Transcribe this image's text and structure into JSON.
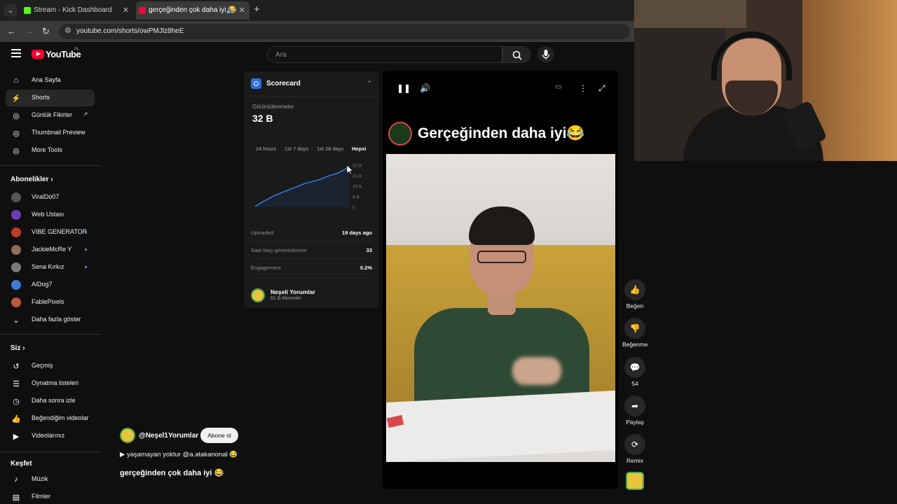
{
  "browser": {
    "tabs": [
      {
        "title": "Stream - Kick Dashboard",
        "favicon_color": "#53fc18"
      },
      {
        "title": "gerçeğinden çok daha iyi 😂",
        "favicon_color": "#ff0033"
      }
    ],
    "url": "youtube.com/shorts/owPMJlz8heE"
  },
  "header": {
    "logo_text": "YouTube",
    "country_code": "PL",
    "search_placeholder": "Ara"
  },
  "sidebar": {
    "main": [
      {
        "label": "Ana Sayfa"
      },
      {
        "label": "Shorts"
      },
      {
        "label": "Günlük Fikirler"
      },
      {
        "label": "Thumbnail Preview"
      },
      {
        "label": "More Tools"
      }
    ],
    "subscriptions_title": "Abonelikler",
    "subscriptions": [
      {
        "label": "ViralDo07",
        "color": "#555555",
        "dot": false
      },
      {
        "label": "Web Ustası",
        "color": "#6a3fb5",
        "dot": false
      },
      {
        "label": "VIBE GENERATOR",
        "color": "#c0392b",
        "dot": true
      },
      {
        "label": "JackieMcRe Y",
        "color": "#8e6f5a",
        "dot": true
      },
      {
        "label": "Sena Kırkız",
        "color": "#7a7a7a",
        "dot": true
      },
      {
        "label": "AiDog7",
        "color": "#3b7bd4",
        "dot": false
      },
      {
        "label": "FablePixels",
        "color": "#b85a3a",
        "dot": false
      }
    ],
    "show_more": "Daha fazla göster",
    "you_title": "Siz",
    "you": [
      {
        "label": "Geçmiş"
      },
      {
        "label": "Oynatma listeleri"
      },
      {
        "label": "Daha sonra izle"
      },
      {
        "label": "Beğendiğim videolar"
      },
      {
        "label": "Videolarınız"
      }
    ],
    "explore_title": "Keşfet",
    "explore": [
      {
        "label": "Müzik"
      },
      {
        "label": "Filmler"
      }
    ]
  },
  "scorecard": {
    "title": "Scorecard",
    "views_label": "Görüntülenmeler",
    "views_value": "32 B",
    "ranges": [
      "24 hours",
      "1st 7 days",
      "1st 28 days",
      "Hepsi"
    ],
    "selected_range": "Hepsi",
    "rows": [
      {
        "label": "Uploaded",
        "value": "19 days ago"
      },
      {
        "label": "Saat başı görüntülenme",
        "value": "33"
      },
      {
        "label": "Engagement",
        "value": "0.2%"
      }
    ],
    "channel_name": "Neşeli Yorumlar",
    "channel_subs": "61 B Aboneler"
  },
  "chart_data": {
    "type": "line",
    "y_tick_labels": [
      "32 B",
      "24 B",
      "16 B",
      "8 B",
      "0"
    ],
    "ylim": [
      0,
      32
    ],
    "x": [
      0,
      1,
      2,
      3,
      4,
      5,
      6,
      7,
      8,
      9,
      10,
      11,
      12,
      13,
      14,
      15,
      16,
      17,
      18,
      19
    ],
    "values": [
      0.5,
      3,
      5,
      7,
      9,
      10.5,
      12,
      13.5,
      15,
      16.5,
      18,
      19,
      20,
      21,
      22.5,
      24,
      25,
      26.5,
      28.5,
      31
    ],
    "color": "#3b82f6"
  },
  "short": {
    "handle": "@Neşel1Yorumlar",
    "subscribe_label": "Abone ol",
    "music_line": "▶ yaşamayan yoktur @a.atakanonal 😂",
    "title": "gerçeğinden çok daha iyi 😂",
    "video_title": "Gerçeğinden daha iyi😂"
  },
  "actions": [
    {
      "label": "Beğen",
      "icon": "thumbs-up-icon",
      "glyph": "👍"
    },
    {
      "label": "Beğenme",
      "icon": "thumbs-down-icon",
      "glyph": "👎"
    },
    {
      "label": "54",
      "icon": "comment-icon",
      "glyph": "💬"
    },
    {
      "label": "Paylaş",
      "icon": "share-icon",
      "glyph": "➦"
    },
    {
      "label": "Remix",
      "icon": "remix-icon",
      "glyph": "⟳"
    }
  ]
}
